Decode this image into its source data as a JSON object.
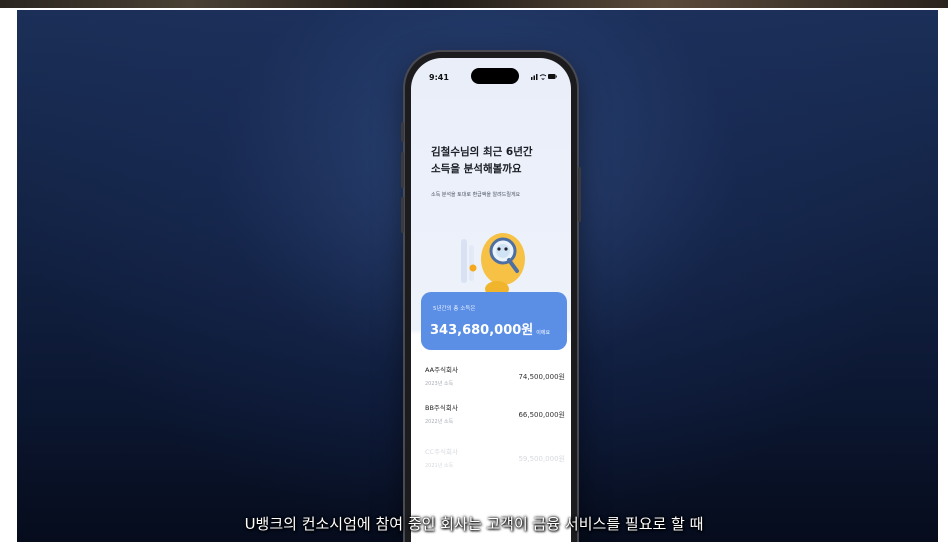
{
  "phone": {
    "status_bar": {
      "time": "9:41",
      "icons": "signal-wifi-battery"
    },
    "headline_line1": "김철수님의 최근 6년간",
    "headline_line2": "소득을 분석해볼까요",
    "subtext": "소득 분석을 토대로 환급액을 알려드릴게요",
    "summary": {
      "label": "5년간의 총 소득은",
      "amount": "343,680,000원",
      "suffix": "이에요"
    },
    "companies": [
      {
        "name": "AA주식회사",
        "year": "2023년 소득",
        "amount": "74,500,000원"
      },
      {
        "name": "BB주식회사",
        "year": "2022년 소득",
        "amount": "66,500,000원"
      },
      {
        "name": "CC주식회사",
        "year": "2021년 소득",
        "amount": "59,500,000원"
      }
    ],
    "colors": {
      "card": "#5b8fe6",
      "screen_bg": "#e9eef9",
      "mascot": "#f6c144"
    }
  },
  "caption": "U뱅크의 컨소시엄에 참여 중인 회사는 고객이 금융 서비스를 필요로 할 때"
}
